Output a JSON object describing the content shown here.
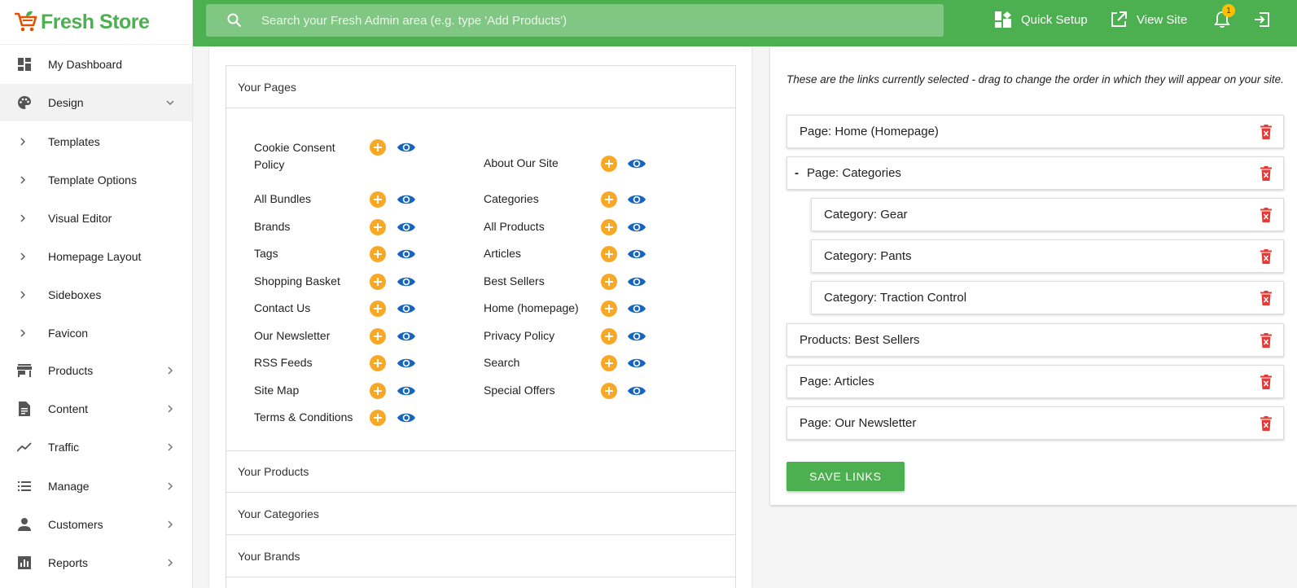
{
  "brand": {
    "name": "Fresh Store",
    "color": "#4caf50",
    "accent": "#e65100"
  },
  "topbar": {
    "search_placeholder": "Search your Fresh Admin area (e.g. type 'Add Products')",
    "quick_setup": "Quick Setup",
    "view_site": "View Site",
    "notification_count": "1"
  },
  "sidebar": {
    "items": [
      {
        "label": "My Dashboard",
        "icon": "dashboard-icon"
      },
      {
        "label": "Design",
        "icon": "palette-icon"
      },
      {
        "label": "Templates"
      },
      {
        "label": "Template Options"
      },
      {
        "label": "Visual Editor"
      },
      {
        "label": "Homepage Layout"
      },
      {
        "label": "Sideboxes"
      },
      {
        "label": "Favicon"
      },
      {
        "label": "Products",
        "icon": "store-icon"
      },
      {
        "label": "Content",
        "icon": "document-icon"
      },
      {
        "label": "Traffic",
        "icon": "trending-icon"
      },
      {
        "label": "Manage",
        "icon": "list-icon"
      },
      {
        "label": "Customers",
        "icon": "person-icon"
      },
      {
        "label": "Reports",
        "icon": "bar-chart-icon"
      }
    ]
  },
  "left_panel": {
    "sections": [
      "Your Pages",
      "Your Products",
      "Your Categories",
      "Your Brands"
    ],
    "pages_col1": [
      "Cookie Consent Policy",
      "All Bundles",
      "Brands",
      "Tags",
      "Shopping Basket",
      "Contact Us",
      "Our Newsletter",
      "RSS Feeds",
      "Site Map",
      "Terms & Conditions"
    ],
    "pages_col2": [
      "About Our Site",
      "Categories",
      "All Products",
      "Articles",
      "Best Sellers",
      "Home (homepage)",
      "Privacy Policy",
      "Search",
      "Special Offers"
    ]
  },
  "right_panel": {
    "description": "These are the links currently selected - drag to change the order in which they will appear on your site.",
    "links": [
      {
        "label": "Page: Home (Homepage)"
      },
      {
        "label": "Page: Categories",
        "prefix": "-"
      },
      {
        "label": "Category: Gear"
      },
      {
        "label": "Category: Pants"
      },
      {
        "label": "Category: Traction Control"
      },
      {
        "label": "Products: Best Sellers"
      },
      {
        "label": "Page: Articles"
      },
      {
        "label": "Page: Our Newsletter"
      }
    ],
    "save_label": "SAVE LINKS"
  },
  "colors": {
    "plus": "#f9a825",
    "eye": "#1565c0",
    "trash": "#e53935",
    "topbar": "#4caf50"
  }
}
